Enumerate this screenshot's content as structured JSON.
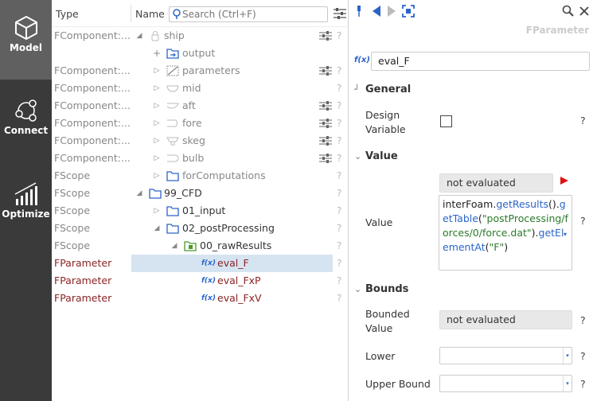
{
  "sidebar": {
    "items": [
      {
        "label": "Model",
        "icon": "cube-icon",
        "active": true
      },
      {
        "label": "Connect",
        "icon": "connect-icon",
        "active": false
      },
      {
        "label": "Optimize",
        "icon": "chart-bars-icon",
        "active": false
      }
    ]
  },
  "tree": {
    "col_type": "Type",
    "col_name": "Name",
    "search_placeholder": "Search (Ctrl+F)",
    "rows": [
      {
        "type": "FComponent:...",
        "name": "ship"
      },
      {
        "type": "",
        "name": "output"
      },
      {
        "type": "FComponent:...",
        "name": "parameters"
      },
      {
        "type": "FComponent:...",
        "name": "mid"
      },
      {
        "type": "FComponent:...",
        "name": "aft"
      },
      {
        "type": "FComponent:...",
        "name": "fore"
      },
      {
        "type": "FComponent:...",
        "name": "skeg"
      },
      {
        "type": "FComponent:...",
        "name": "bulb"
      },
      {
        "type": "FScope",
        "name": "forComputations"
      },
      {
        "type": "FScope",
        "name": "99_CFD"
      },
      {
        "type": "FScope",
        "name": "01_input"
      },
      {
        "type": "FScope",
        "name": "02_postProcessing"
      },
      {
        "type": "FScope",
        "name": "00_rawResults"
      },
      {
        "type": "FParameter",
        "name": "eval_F"
      },
      {
        "type": "FParameter",
        "name": "eval_FxP"
      },
      {
        "type": "FParameter",
        "name": "eval_FxV"
      }
    ],
    "q": "?"
  },
  "props": {
    "title": "FParameter",
    "fx_label": "f(x)",
    "name_value": "eval_F",
    "general": {
      "header": "General",
      "design_variable_label": "Design Variable",
      "design_variable_checked": false
    },
    "value": {
      "header": "Value",
      "status": "not evaluated",
      "label": "Value",
      "expr_p1": "interFoam.",
      "expr_p2": "getResults",
      "expr_p3": "().",
      "expr_p4": "getTable",
      "expr_p5": "(",
      "expr_p6": "\"postProcessing/forces/0/force.dat\"",
      "expr_p7": ").",
      "expr_p8": "getElementAt",
      "expr_p9": "(",
      "expr_p10": "\"F\"",
      "expr_p11": ")"
    },
    "bounds": {
      "header": "Bounds",
      "bounded_label": "Bounded Value",
      "bounded_value": "not evaluated",
      "lower_label": "Lower",
      "upper_label": "Upper Bound"
    },
    "q": "?"
  }
}
